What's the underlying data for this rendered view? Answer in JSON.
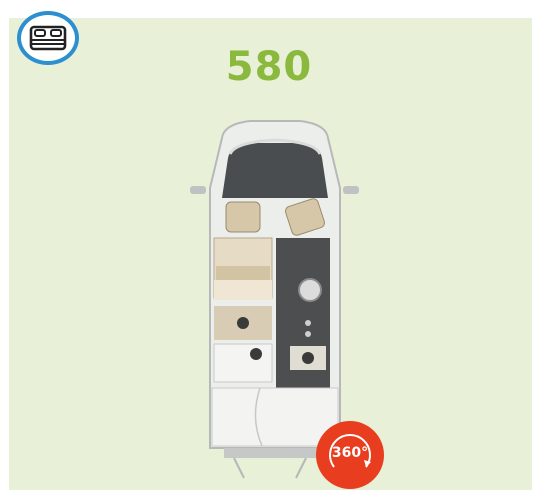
{
  "model": {
    "title": "580"
  },
  "badge": {
    "icon": "bed-icon",
    "color": "#2c8fcf"
  },
  "view360": {
    "label": "360°",
    "icon": "rotate-360-icon",
    "color": "#e83e1f"
  },
  "colors": {
    "background": "#e8f0d7",
    "title": "#8ab93e"
  }
}
